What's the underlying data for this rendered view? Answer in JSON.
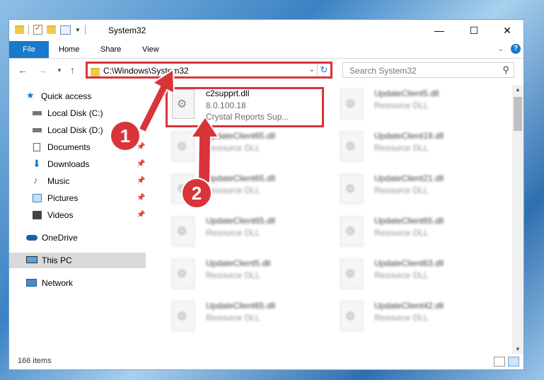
{
  "window": {
    "title": "System32",
    "controls": {
      "minimize": "—",
      "maximize": "☐",
      "close": "✕"
    }
  },
  "ribbon": {
    "file": "File",
    "tabs": [
      "Home",
      "Share",
      "View"
    ]
  },
  "address": {
    "path": "C:\\Windows\\System32",
    "search_placeholder": "Search System32"
  },
  "nav": {
    "items": [
      {
        "label": "Quick access",
        "icon": "star-icon"
      },
      {
        "label": "Local Disk (C:)",
        "icon": "drive-icon"
      },
      {
        "label": "Local Disk (D:)",
        "icon": "drive-icon"
      },
      {
        "label": "Documents",
        "icon": "documents-icon"
      },
      {
        "label": "Downloads",
        "icon": "download-icon"
      },
      {
        "label": "Music",
        "icon": "music-icon"
      },
      {
        "label": "Pictures",
        "icon": "pictures-icon"
      },
      {
        "label": "Videos",
        "icon": "videos-icon"
      },
      {
        "label": "OneDrive",
        "icon": "cloud-icon"
      },
      {
        "label": "This PC",
        "icon": "computer-icon"
      },
      {
        "label": "Network",
        "icon": "network-icon"
      }
    ]
  },
  "files": {
    "highlighted": {
      "name": "c2supprt.dll",
      "version": "8.0.100.18",
      "description": "Crystal Reports Sup..."
    },
    "left_column": [
      {
        "name": "UpdateClient65.dll",
        "type": "Resource DLL"
      },
      {
        "name": "UpdateClient65.dll",
        "type": "Resource DLL"
      },
      {
        "name": "UpdateClient65.dll",
        "type": "Resource DLL"
      },
      {
        "name": "UpdateClient5.dll",
        "type": "Resource DLL"
      },
      {
        "name": "UpdateClient65.dll",
        "type": "Resource DLL"
      }
    ],
    "right_column": [
      {
        "name": "UpdateClient5.dll",
        "type": "Resource DLL"
      },
      {
        "name": "UpdateClient19.dll",
        "type": "Resource DLL"
      },
      {
        "name": "UpdateClient21.dll",
        "type": "Resource DLL"
      },
      {
        "name": "UpdateClient65.dll",
        "type": "Resource DLL"
      },
      {
        "name": "UpdateClient63.dll",
        "type": "Resource DLL"
      },
      {
        "name": "UpdateClient42.dll",
        "type": "Resource DLL"
      }
    ]
  },
  "status": {
    "items": "166 items"
  },
  "callouts": {
    "one": "1",
    "two": "2"
  },
  "colors": {
    "accent": "#1979ca",
    "highlight": "#d9343a",
    "selected": "#d9d9d9"
  }
}
